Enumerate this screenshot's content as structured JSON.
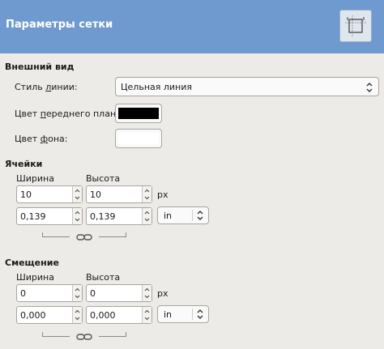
{
  "header": {
    "title": "Параметры сетки",
    "icon": "grid-icon"
  },
  "appearance": {
    "title": "Внешний вид",
    "line_style_label_pre": "Стиль ",
    "line_style_label_mn": "л",
    "line_style_label_post": "инии:",
    "line_style_value": "Цельная линия",
    "fg_label_pre": "Цвет ",
    "fg_label_mn": "п",
    "fg_label_post": "ереднего плана:",
    "fg_color": "#000000",
    "bg_label_pre": "Цвет ",
    "bg_label_mn": "ф",
    "bg_label_post": "она:",
    "bg_color": "#ffffff"
  },
  "cells": {
    "title": "Ячейки",
    "width_label": "Ширина",
    "height_label": "Высота",
    "width_px": "10",
    "height_px": "10",
    "px_unit": "px",
    "width_res": "0,139",
    "height_res": "0,139",
    "res_unit": "in"
  },
  "offset": {
    "title": "Смещение",
    "width_label": "Ширина",
    "height_label": "Высота",
    "width_px": "0",
    "height_px": "0",
    "px_unit": "px",
    "width_res": "0,000",
    "height_res": "0,000",
    "res_unit": "in"
  }
}
